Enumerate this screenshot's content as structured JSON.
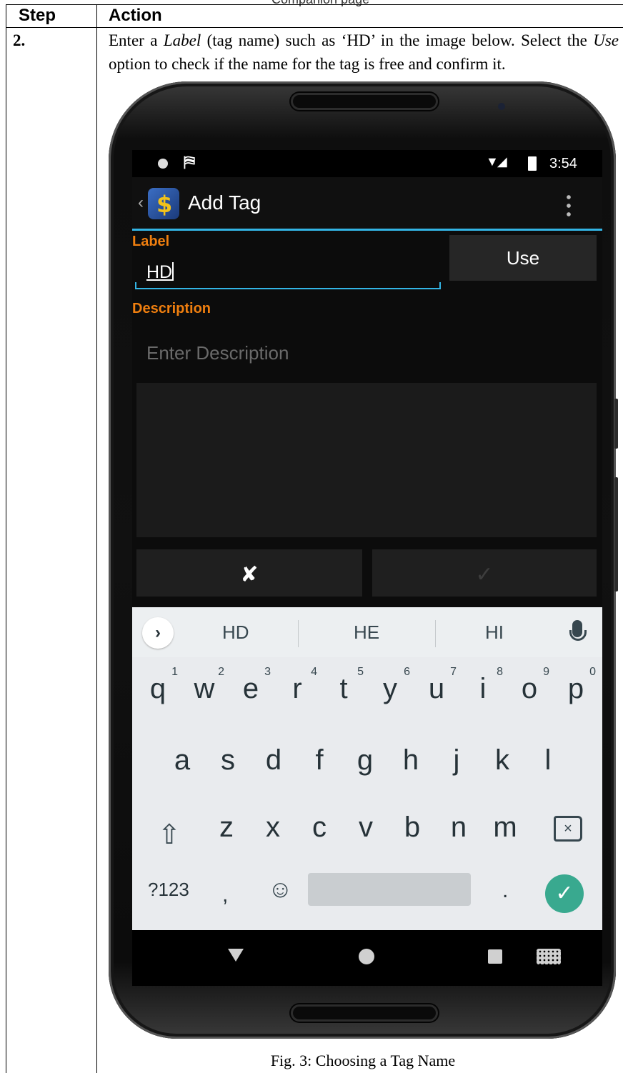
{
  "header_fragment": "Companion page",
  "table": {
    "col_step": "Step",
    "col_action": "Action",
    "step_number": "2.",
    "instruction": {
      "p1": "Enter a ",
      "label_em": "Label",
      "p2": " (tag name) such as ‘HD’ in the image below. Select the ",
      "use_em": "Use",
      "p3": " option to check if the name for the tag is free and confirm it."
    },
    "caption": "Fig. 3: Choosing a Tag Name"
  },
  "status_bar": {
    "time": "3:54"
  },
  "action_bar": {
    "title": "Add Tag"
  },
  "form": {
    "label_heading": "Label",
    "label_value": "HD",
    "use_button": "Use",
    "description_heading": "Description",
    "description_placeholder": "Enter Description",
    "cancel_glyph": "✘",
    "confirm_glyph": "✓"
  },
  "keyboard": {
    "expand_glyph": "›",
    "suggestions": [
      "HD",
      "HE",
      "HI"
    ],
    "row1": [
      {
        "k": "q",
        "n": "1"
      },
      {
        "k": "w",
        "n": "2"
      },
      {
        "k": "e",
        "n": "3"
      },
      {
        "k": "r",
        "n": "4"
      },
      {
        "k": "t",
        "n": "5"
      },
      {
        "k": "y",
        "n": "6"
      },
      {
        "k": "u",
        "n": "7"
      },
      {
        "k": "i",
        "n": "8"
      },
      {
        "k": "o",
        "n": "9"
      },
      {
        "k": "p",
        "n": "0"
      }
    ],
    "row2": [
      "a",
      "s",
      "d",
      "f",
      "g",
      "h",
      "j",
      "k",
      "l"
    ],
    "row3": [
      "z",
      "x",
      "c",
      "v",
      "b",
      "n",
      "m"
    ],
    "symbols_key": "?123",
    "comma_key": ",",
    "period_key": ".",
    "shift_glyph": "⇧",
    "backspace_glyph": "×",
    "emoji_glyph": "☺",
    "enter_glyph": "✓"
  },
  "colors": {
    "accent_blue": "#33b5e5",
    "label_orange": "#f07f0f",
    "enter_green": "#39a98f"
  }
}
